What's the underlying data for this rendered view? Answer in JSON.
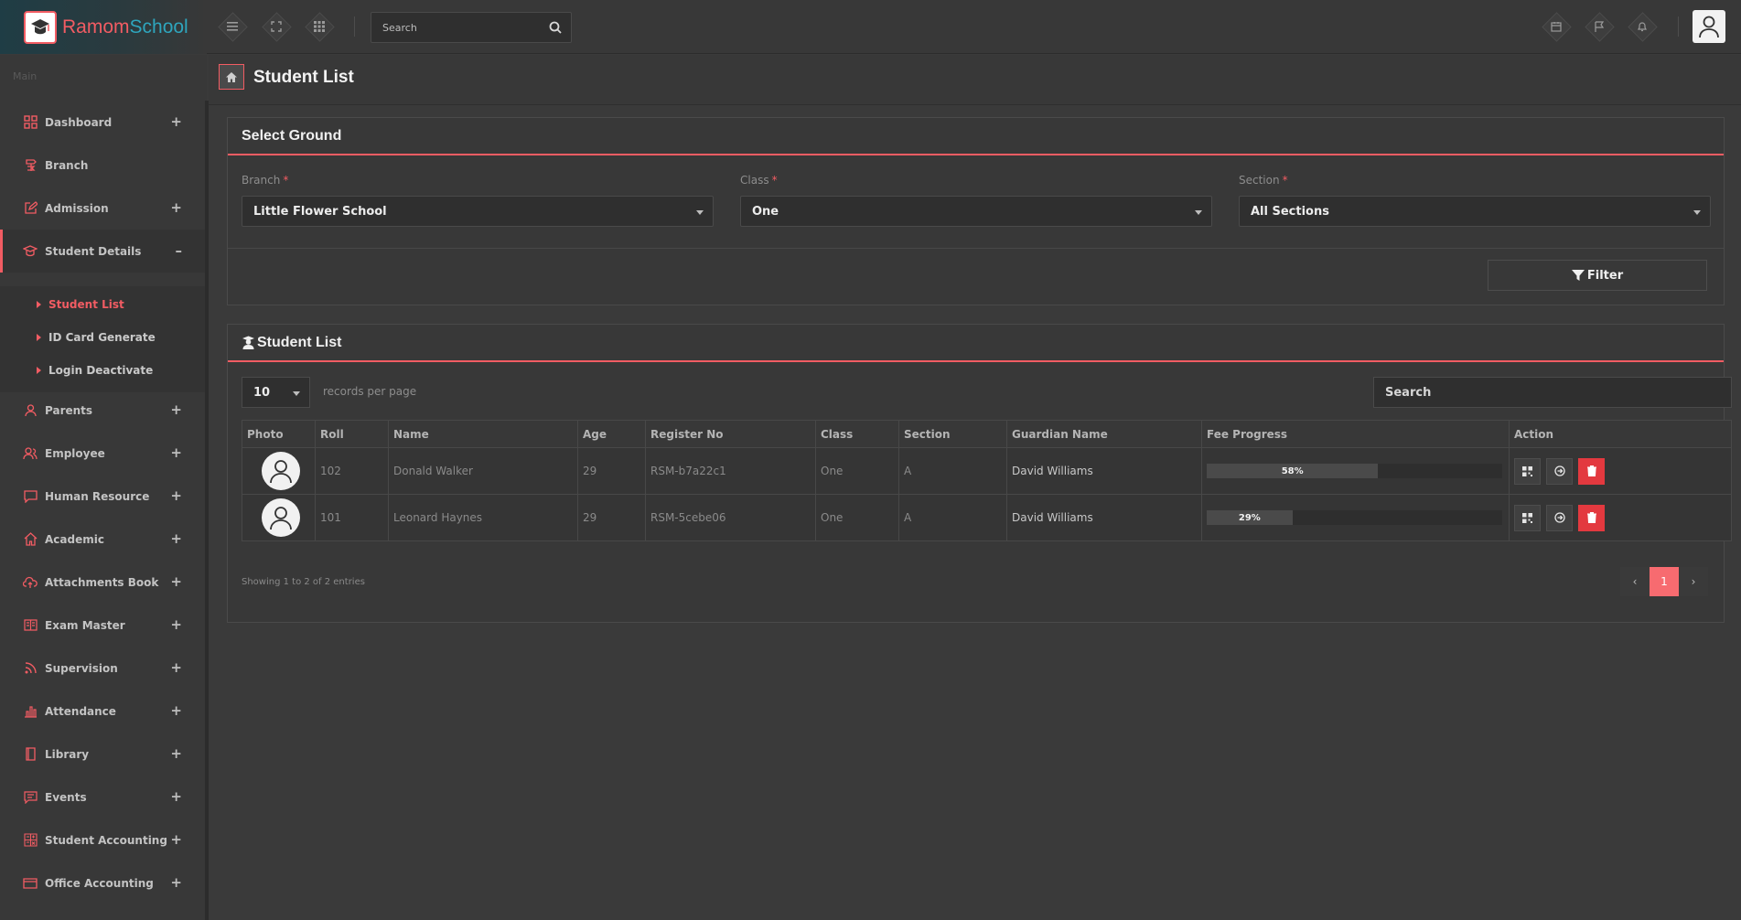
{
  "brand": {
    "name_part1": "Ramom",
    "name_part2": "School"
  },
  "header": {
    "search_placeholder": "Search"
  },
  "sidebar": {
    "heading": "Main",
    "items": [
      {
        "label": "Dashboard",
        "icon": "dashboard-icon",
        "expandable": true
      },
      {
        "label": "Branch",
        "icon": "branch-icon",
        "expandable": false
      },
      {
        "label": "Admission",
        "icon": "edit-icon",
        "expandable": true
      },
      {
        "label": "Student Details",
        "icon": "graduation-cap-icon",
        "expandable": true,
        "expanded": true
      },
      {
        "label": "Parents",
        "icon": "user-icon",
        "expandable": true
      },
      {
        "label": "Employee",
        "icon": "user-group-icon",
        "expandable": true
      },
      {
        "label": "Human Resource",
        "icon": "monitor-icon",
        "expandable": true
      },
      {
        "label": "Academic",
        "icon": "home-icon",
        "expandable": true
      },
      {
        "label": "Attachments Book",
        "icon": "cloud-upload-icon",
        "expandable": true
      },
      {
        "label": "Exam Master",
        "icon": "book-icon",
        "expandable": true
      },
      {
        "label": "Supervision",
        "icon": "rss-icon",
        "expandable": true
      },
      {
        "label": "Attendance",
        "icon": "bar-chart-icon",
        "expandable": true
      },
      {
        "label": "Library",
        "icon": "library-icon",
        "expandable": true
      },
      {
        "label": "Events",
        "icon": "message-icon",
        "expandable": true
      },
      {
        "label": "Student Accounting",
        "icon": "calculator-icon",
        "expandable": true
      },
      {
        "label": "Office Accounting",
        "icon": "credit-card-icon",
        "expandable": true
      }
    ],
    "student_details_sub": [
      "Student List",
      "ID Card Generate",
      "Login Deactivate"
    ],
    "plus": "+",
    "minus": "–"
  },
  "page": {
    "title": "Student List"
  },
  "filter_panel": {
    "title": "Select Ground",
    "branch_label": "Branch",
    "branch_value": "Little Flower School",
    "class_label": "Class",
    "class_value": "One",
    "section_label": "Section",
    "section_value": "All Sections",
    "required_mark": "*",
    "filter_button": "Filter"
  },
  "list_panel": {
    "title": "Student List",
    "page_length": "10",
    "length_label": "records per page",
    "search_placeholder": "Search",
    "columns": [
      "Photo",
      "Roll",
      "Name",
      "Age",
      "Register No",
      "Class",
      "Section",
      "Guardian Name",
      "Fee Progress",
      "Action"
    ],
    "rows": [
      {
        "roll": "102",
        "name": "Donald Walker",
        "age": "29",
        "register_no": "RSM-b7a22c1",
        "class": "One",
        "section": "A",
        "guardian": "David Williams",
        "fee_progress": 58,
        "fee_label": "58%"
      },
      {
        "roll": "101",
        "name": "Leonard Haynes",
        "age": "29",
        "register_no": "RSM-5cebe06",
        "class": "One",
        "section": "A",
        "guardian": "David Williams",
        "fee_progress": 29,
        "fee_label": "29%"
      }
    ],
    "info": "Showing 1 to 2 of 2 entries",
    "pagination": {
      "current": "1",
      "prev": "‹",
      "next": "›"
    }
  },
  "colors": {
    "accent": "#f25c63",
    "brand_teal": "#2ea5bd",
    "delete": "#e3393f"
  }
}
